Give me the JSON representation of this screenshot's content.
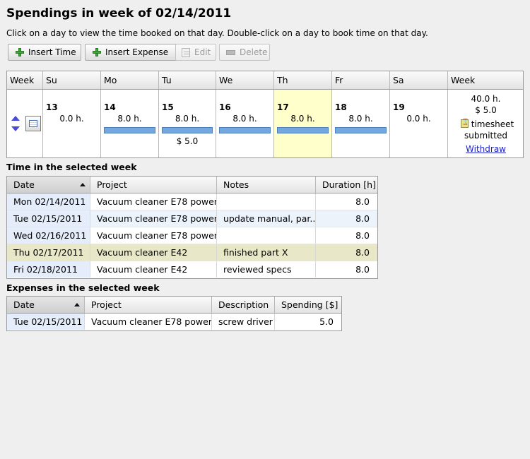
{
  "title": "Spendings in week of 02/14/2011",
  "instructions": "Click on a day to view the time booked on that day. Double-click on a day to book time on that day.",
  "toolbar": {
    "insert_time": "Insert Time",
    "insert_expense": "Insert Expense",
    "edit": "Edit",
    "delete": "Delete"
  },
  "calendar": {
    "headers": [
      "Week",
      "Su",
      "Mo",
      "Tu",
      "We",
      "Th",
      "Fr",
      "Sa",
      "Week"
    ],
    "days": [
      {
        "num": "13",
        "hours": "0.0 h.",
        "bar": false,
        "spend": ""
      },
      {
        "num": "14",
        "hours": "8.0 h.",
        "bar": true,
        "spend": ""
      },
      {
        "num": "15",
        "hours": "8.0 h.",
        "bar": true,
        "spend": "$ 5.0"
      },
      {
        "num": "16",
        "hours": "8.0 h.",
        "bar": true,
        "spend": ""
      },
      {
        "num": "17",
        "hours": "8.0 h.",
        "bar": true,
        "spend": ""
      },
      {
        "num": "18",
        "hours": "8.0 h.",
        "bar": true,
        "spend": ""
      },
      {
        "num": "19",
        "hours": "0.0 h.",
        "bar": false,
        "spend": ""
      }
    ],
    "week_total_hours": "40.0 h.",
    "week_total_spend": "$ 5.0",
    "status_line1": "timesheet",
    "status_line2": "submitted",
    "withdraw": "Withdraw"
  },
  "time_section": {
    "label": "Time in the selected week",
    "columns": [
      "Date",
      "Project",
      "Notes",
      "Duration [h]"
    ],
    "rows": [
      [
        "Mon 02/14/2011",
        "Vacuum cleaner E78 power",
        "",
        "8.0"
      ],
      [
        "Tue 02/15/2011",
        "Vacuum cleaner E78 power",
        "update manual, par..",
        "8.0"
      ],
      [
        "Wed 02/16/2011",
        "Vacuum cleaner E78 power",
        "",
        "8.0"
      ],
      [
        "Thu 02/17/2011",
        "Vacuum cleaner E42",
        "finished part X",
        "8.0"
      ],
      [
        "Fri 02/18/2011",
        "Vacuum cleaner E42",
        "reviewed specs",
        "8.0"
      ]
    ]
  },
  "expense_section": {
    "label": "Expenses in the selected week",
    "columns": [
      "Date",
      "Project",
      "Description",
      "Spending [$]"
    ],
    "rows": [
      [
        "Tue 02/15/2011",
        "Vacuum cleaner E78 power",
        "screw driver",
        "5.0"
      ]
    ]
  }
}
